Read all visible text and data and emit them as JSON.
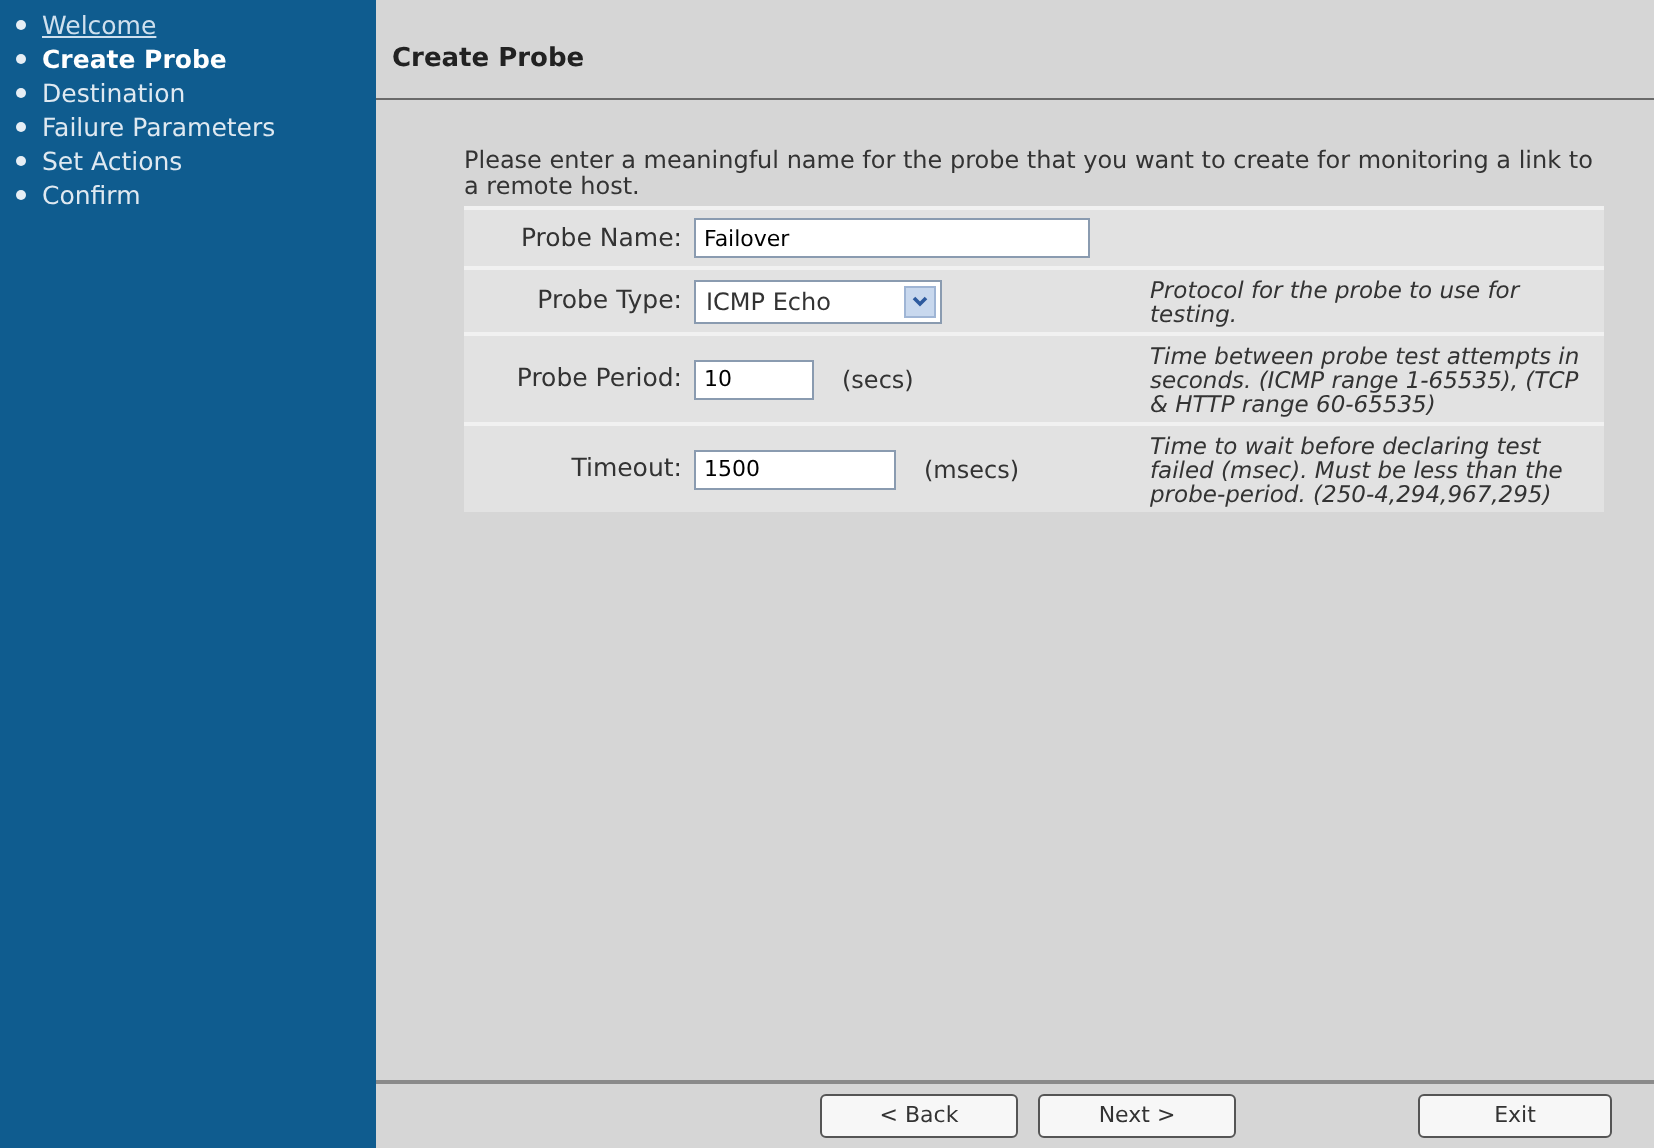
{
  "sidebar": {
    "items": [
      {
        "label": "Welcome",
        "kind": "link",
        "selected": false
      },
      {
        "label": "Create Probe",
        "kind": "step",
        "selected": true
      },
      {
        "label": "Destination",
        "kind": "step",
        "selected": false
      },
      {
        "label": "Failure Parameters",
        "kind": "step",
        "selected": false
      },
      {
        "label": "Set Actions",
        "kind": "step",
        "selected": false
      },
      {
        "label": "Confirm",
        "kind": "step",
        "selected": false
      }
    ]
  },
  "page": {
    "title": "Create Probe",
    "intro": "Please enter a meaningful name for the probe that you want to create for monitoring a link to a remote host."
  },
  "form": {
    "rows": [
      {
        "label": "Probe Name:",
        "kind": "text",
        "value": "Failover"
      },
      {
        "label": "Probe Type:",
        "kind": "select",
        "value": "ICMP Echo",
        "help": "Protocol for the probe to use for testing."
      },
      {
        "label": "Probe Period:",
        "kind": "short",
        "value": "10",
        "unit": "(secs)",
        "help": "Time between probe test attempts in seconds. (ICMP range 1-65535), (TCP & HTTP range 60-65535)"
      },
      {
        "label": "Timeout:",
        "kind": "medium",
        "value": "1500",
        "unit": "(msecs)",
        "help": "Time to wait before declaring test failed (msec). Must be less than the probe-period. (250-4,294,967,295)"
      }
    ]
  },
  "buttons": [
    {
      "label": "< Back",
      "kind": "nav"
    },
    {
      "label": "Next >",
      "kind": "nav"
    },
    {
      "label": "Exit",
      "kind": "exit"
    }
  ]
}
